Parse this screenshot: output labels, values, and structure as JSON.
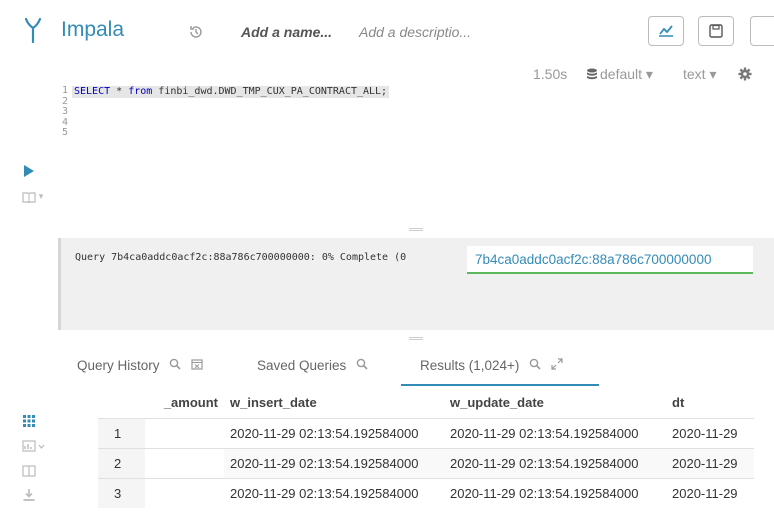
{
  "header": {
    "app_title": "Impala",
    "query_name": "Add a name...",
    "query_description": "Add a descriptio...",
    "logo_icon": "impala-logo-icon",
    "history_icon": "history-icon",
    "buttons": [
      "chart-icon",
      "save-icon",
      "more-button"
    ]
  },
  "status": {
    "exec_time": "1.50s",
    "database": "default ▾",
    "format": "text ▾"
  },
  "editor": {
    "line_numbers": [
      "1",
      "2",
      "3",
      "4",
      "5"
    ],
    "kw_select": "SELECT",
    "star": " * ",
    "kw_from": "from",
    "table": " finbi_dwd.DWD_TMP_CUX_PA_CONTRACT_ALL;"
  },
  "log": {
    "text": "Query 7b4ca0addc0acf2c:88a786c700000000: 0% Complete (0",
    "link": "7b4ca0addc0acf2c:88a786c700000000"
  },
  "tabs": {
    "query_history": "Query History",
    "saved_queries": "Saved Queries",
    "results": "Results (1,024+)"
  },
  "results": {
    "columns": [
      "_amount",
      "w_insert_date",
      "w_update_date",
      "dt"
    ],
    "rows": [
      {
        "num": "1",
        "amount": "",
        "insert": "2020-11-29 02:13:54.192584000",
        "update": "2020-11-29 02:13:54.192584000",
        "dt": "2020-11-29"
      },
      {
        "num": "2",
        "amount": "",
        "insert": "2020-11-29 02:13:54.192584000",
        "update": "2020-11-29 02:13:54.192584000",
        "dt": "2020-11-29"
      },
      {
        "num": "3",
        "amount": "",
        "insert": "2020-11-29 02:13:54.192584000",
        "update": "2020-11-29 02:13:54.192584000",
        "dt": "2020-11-29"
      }
    ]
  },
  "colors": {
    "accent": "#338bb8",
    "success": "#5cb85c"
  }
}
